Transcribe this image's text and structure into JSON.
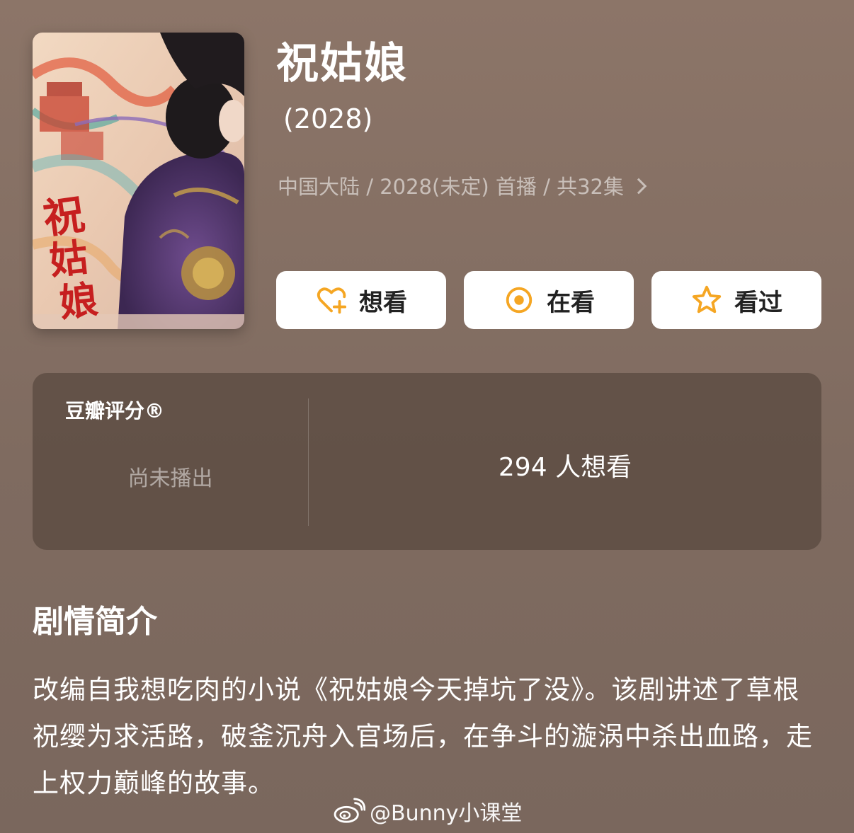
{
  "drama": {
    "title": "祝姑娘",
    "year": "(2028)",
    "meta": "中国大陆 / 2028(未定) 首播 / 共32集",
    "poster_title_art": "祝姑娘"
  },
  "actions": {
    "want": "想看",
    "watching": "在看",
    "watched": "看过"
  },
  "rating": {
    "label": "豆瓣评分®",
    "status": "尚未播出",
    "want_count": "294 人想看"
  },
  "synopsis": {
    "title": "剧情简介",
    "text": "改编自我想吃肉的小说《祝姑娘今天掉坑了没》。该剧讲述了草根祝缨为求活路，破釜沉舟入官场后，在争斗的漩涡中杀出血路，走上权力巅峰的故事。"
  },
  "watermark": {
    "text": "@Bunny小课堂"
  },
  "colors": {
    "accent": "#f5a623",
    "background": "#8a7466",
    "panel": "#5e4f45"
  }
}
